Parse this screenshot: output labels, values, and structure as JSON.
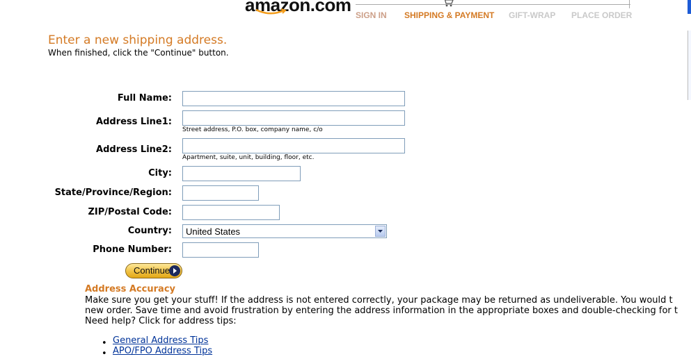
{
  "header": {
    "logo_text": "amazon.com",
    "steps": [
      {
        "label": "SIGN IN",
        "state": "inactive"
      },
      {
        "label": "SHIPPING & PAYMENT",
        "state": "active"
      },
      {
        "label": "GIFT-WRAP",
        "state": "future"
      },
      {
        "label": "PLACE ORDER",
        "state": "future"
      }
    ]
  },
  "page": {
    "title": "Enter a new shipping address.",
    "subtitle": "When finished, click the \"Continue\" button."
  },
  "form": {
    "full_name_label": "Full Name:",
    "full_name_value": "",
    "address1_label": "Address Line1:",
    "address1_value": "",
    "address1_hint": "Street address, P.O. box, company name, c/o",
    "address2_label": "Address Line2:",
    "address2_value": "",
    "address2_hint": "Apartment, suite, unit, building, floor, etc.",
    "city_label": "City:",
    "city_value": "",
    "state_label": "State/Province/Region:",
    "state_value": "",
    "zip_label": "ZIP/Postal Code:",
    "zip_value": "",
    "country_label": "Country:",
    "country_value": "United States",
    "phone_label": "Phone Number:",
    "phone_value": "",
    "continue_label": "Continue"
  },
  "accuracy": {
    "heading": "Address Accuracy",
    "lines": [
      "Make sure you get your stuff! If the address is not entered correctly, your package may be returned as undeliverable. You would t",
      "new order. Save time and avoid frustration by entering the address information in the appropriate boxes and double-checking for t",
      "Need help? Click for address tips:"
    ],
    "tips": [
      "General Address Tips",
      "APO/FPO Address Tips"
    ]
  },
  "colors": {
    "accent_orange": "#d47a24",
    "link_blue": "#003399",
    "input_border": "#7f9db9"
  }
}
